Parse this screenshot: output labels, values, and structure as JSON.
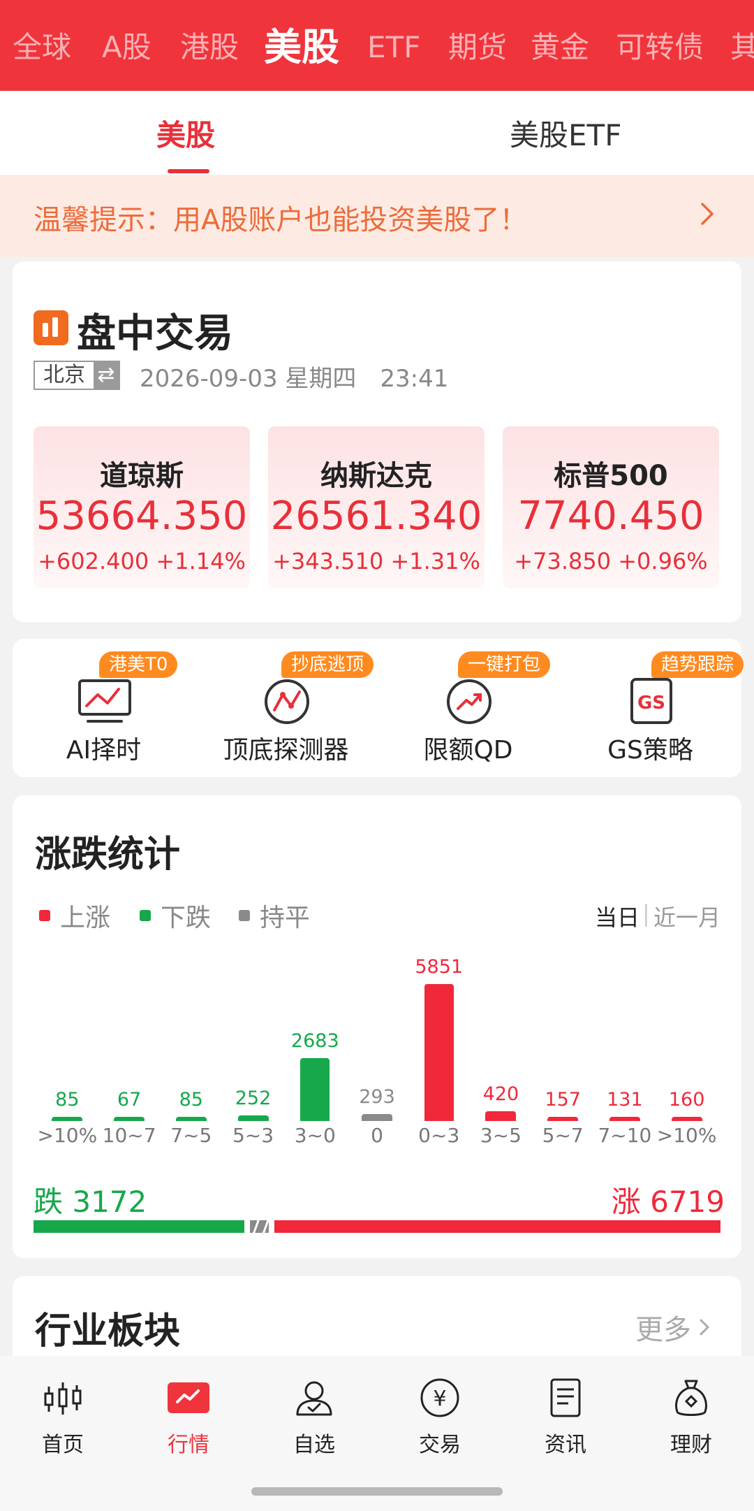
{
  "top_tabs": [
    "全球",
    "A股",
    "港股",
    "美股",
    "ETF",
    "期货",
    "黄金",
    "可转债",
    "其"
  ],
  "active_top_tab": "美股",
  "sub_tabs": [
    "美股",
    "美股ETF"
  ],
  "notice": {
    "text": "温馨提示：用A股账户也能投资美股了！",
    "icon": "chevron-right-icon"
  },
  "intraday": {
    "title": "盘中交易",
    "location": "北京",
    "swap_icon": "swap-icon",
    "datetime": "2026-09-03 星期四　23:41",
    "indices": [
      {
        "name": "道琼斯",
        "value": "53664.350",
        "change": "+602.400",
        "pct": "+1.14%"
      },
      {
        "name": "纳斯达克",
        "value": "26561.340",
        "change": "+343.510",
        "pct": "+1.31%"
      },
      {
        "name": "标普500",
        "value": "7740.450",
        "change": "+73.850",
        "pct": "+0.96%"
      }
    ]
  },
  "tools": [
    {
      "label": "AI择时",
      "badge": "港美T0",
      "icon": "ai-timing-icon"
    },
    {
      "label": "顶底探测器",
      "badge": "抄底逃顶",
      "icon": "detector-icon"
    },
    {
      "label": "限额QD",
      "badge": "一键打包",
      "icon": "qd-icon"
    },
    {
      "label": "GS策略",
      "badge": "趋势跟踪",
      "icon": "gs-icon"
    }
  ],
  "stats": {
    "title": "涨跌统计",
    "legend": [
      "上涨",
      "下跌",
      "持平"
    ],
    "periods": [
      "当日",
      "近一月"
    ],
    "active_period": "当日",
    "fall_total": "跌 3172",
    "rise_total": "涨 6719"
  },
  "chart_data": {
    "type": "bar",
    "categories": [
      ">10%",
      "10~7",
      "7~5",
      "5~3",
      "3~0",
      "0",
      "0~3",
      "3~5",
      "5~7",
      "7~10",
      ">10%"
    ],
    "values": [
      85,
      67,
      85,
      252,
      2683,
      293,
      5851,
      420,
      157,
      131,
      160
    ],
    "kinds": [
      "fall",
      "fall",
      "fall",
      "fall",
      "fall",
      "flat",
      "rise",
      "rise",
      "rise",
      "rise",
      "rise"
    ],
    "series_names": [
      "上涨",
      "下跌",
      "持平"
    ],
    "totals": {
      "fall": 3172,
      "flat": 293,
      "rise": 6719
    },
    "colors": {
      "rise": "#f0283a",
      "fall": "#16a84b",
      "flat": "#8a8a8a"
    }
  },
  "industry": {
    "title": "行业板块",
    "more": "更多"
  },
  "bottom_nav": [
    {
      "label": "首页",
      "icon": "home-candle-icon"
    },
    {
      "label": "行情",
      "icon": "market-icon"
    },
    {
      "label": "自选",
      "icon": "watchlist-icon"
    },
    {
      "label": "交易",
      "icon": "trade-yen-icon"
    },
    {
      "label": "资讯",
      "icon": "news-icon"
    },
    {
      "label": "理财",
      "icon": "wealth-bag-icon"
    }
  ],
  "active_bottom": "行情",
  "colors": {
    "brand_red": "#f0343c",
    "accent_orange": "#ff8a1f",
    "rise": "#f0283a",
    "fall": "#16a84b"
  }
}
